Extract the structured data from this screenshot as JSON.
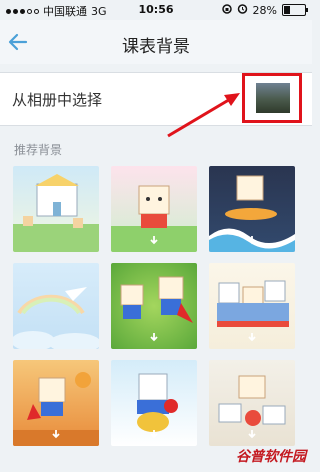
{
  "status_bar": {
    "carrier": "中国联通",
    "network": "3G",
    "time": "10:56",
    "battery": "28%",
    "battery_level": 0.28
  },
  "header": {
    "title": "课表背景"
  },
  "album_row": {
    "label": "从相册中选择"
  },
  "section": {
    "label": "推荐背景"
  },
  "watermark": "谷普软件园",
  "colors": {
    "accent": "#4aa0d8",
    "annotation_red": "#e0131b"
  }
}
